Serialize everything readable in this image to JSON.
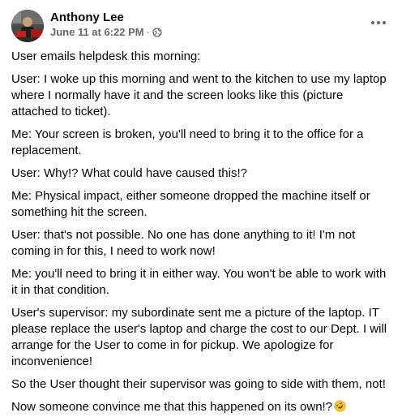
{
  "post": {
    "author_name": "Anthony Lee",
    "timestamp": "June 11 at 6:22 PM",
    "separator": "·",
    "audience_icon": "globe-icon",
    "more_icon": "more-options-icon",
    "paragraphs": [
      "User emails helpdesk this morning:",
      "User: I woke up this morning and went to the kitchen to use my laptop where I normally have it and the screen looks like this (picture attached to ticket).",
      "Me: Your screen is broken, you'll need to bring it to the office for a replacement.",
      "User: Why!? What could have caused this!?",
      "Me: Physical impact, either someone dropped the machine itself or something hit the screen.",
      "User: that's not possible. No one has done anything to it! I'm not coming in for this, I need to work now!",
      "Me: you'll need to bring it in either way. You won't be able to work with it in that condition.",
      "User's supervisor: my subordinate sent me a picture of the laptop. IT please replace the user's laptop and charge the cost to our Dept. I will arrange for the User to come in for pickup. We apologize for inconvenience!",
      "So the User thought their supervisor was going to side with them, not!",
      "Now someone convince me that this happened on its own!?"
    ],
    "final_emoji": "rolling-on-the-floor-laughing-emoji"
  },
  "colors": {
    "text_primary": "#050505",
    "text_secondary": "#65676b",
    "background": "#ffffff"
  }
}
